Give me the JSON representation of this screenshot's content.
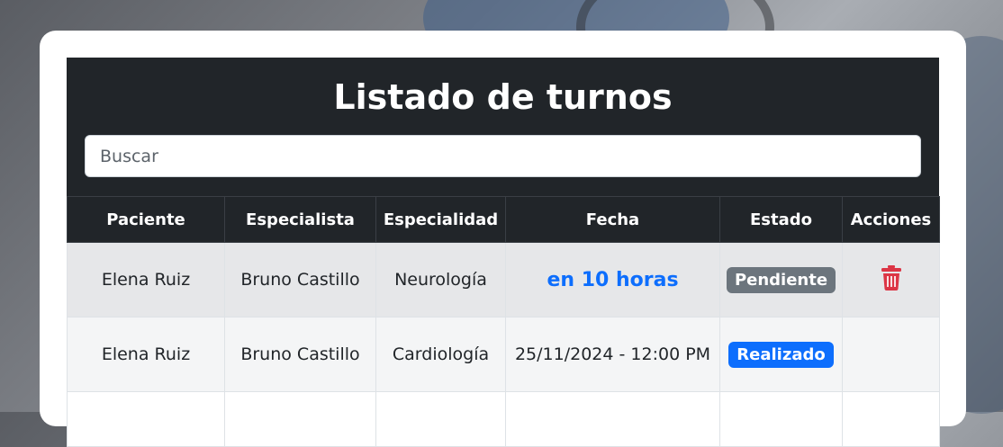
{
  "page": {
    "title": "Listado de turnos",
    "search": {
      "placeholder": "Buscar",
      "value": ""
    }
  },
  "table": {
    "headers": [
      "Paciente",
      "Especialista",
      "Especialidad",
      "Fecha",
      "Estado",
      "Acciones"
    ],
    "rows": [
      {
        "paciente": "Elena Ruiz",
        "especialista": "Bruno Castillo",
        "especialidad": "Neurología",
        "fecha": "en 10 horas",
        "estado": "Pendiente",
        "acciones": [
          "trash-icon"
        ]
      },
      {
        "paciente": "Elena Ruiz",
        "especialista": "Bruno Castillo",
        "especialidad": "Cardiología",
        "fecha": "25/11/2024 - 12:00 PM",
        "estado": "Realizado",
        "acciones": []
      }
    ]
  },
  "colors": {
    "panel": "#212529",
    "accent_blue": "#0d6efd",
    "pending_gray": "#6c757d",
    "danger_red": "#dc3545"
  }
}
